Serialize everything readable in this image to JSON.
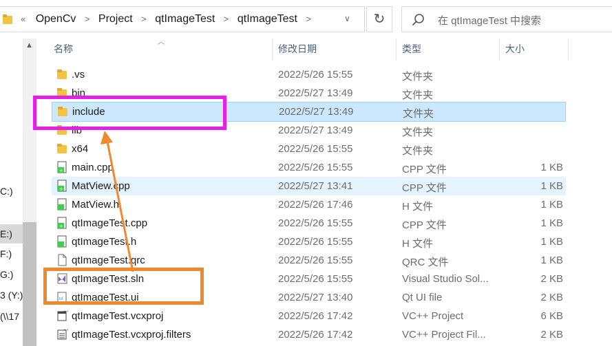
{
  "address": {
    "overflow": "«",
    "crumbs": [
      "OpenCv",
      "Project",
      "qtImageTest",
      "qtImageTest"
    ],
    "dropdown": "∨",
    "refresh": "↻"
  },
  "search": {
    "placeholder": "在 qtImageTest 中搜索"
  },
  "columns": {
    "name": "名称",
    "date": "修改日期",
    "type": "类型",
    "size": "大小"
  },
  "sidebar": {
    "drives": [
      {
        "label": "C:)"
      },
      {
        "label": "E:)"
      },
      {
        "label": "F:)"
      },
      {
        "label": "G:)"
      },
      {
        "label": "3 (Y:)"
      },
      {
        "label": "(\\\\17"
      }
    ]
  },
  "files": [
    {
      "name": ".vs",
      "date": "2022/5/26 15:55",
      "type": "文件夹",
      "size": "",
      "icon": "folder-icon"
    },
    {
      "name": "bin",
      "date": "2022/5/27 13:49",
      "type": "文件夹",
      "size": "",
      "icon": "folder-icon"
    },
    {
      "name": "include",
      "date": "2022/5/27 13:49",
      "type": "文件夹",
      "size": "",
      "icon": "folder-icon"
    },
    {
      "name": "lib",
      "date": "2022/5/27 13:49",
      "type": "文件夹",
      "size": "",
      "icon": "folder-icon"
    },
    {
      "name": "x64",
      "date": "2022/5/26 15:55",
      "type": "文件夹",
      "size": "",
      "icon": "folder-icon"
    },
    {
      "name": "main.cpp",
      "date": "2022/5/26 15:55",
      "type": "CPP 文件",
      "size": "1 KB",
      "icon": "cpp-file-icon"
    },
    {
      "name": "MatView.cpp",
      "date": "2022/5/27 13:41",
      "type": "CPP 文件",
      "size": "1 KB",
      "icon": "cpp-file-icon"
    },
    {
      "name": "MatView.h",
      "date": "2022/5/26 17:46",
      "type": "H 文件",
      "size": "1 KB",
      "icon": "h-file-icon"
    },
    {
      "name": "qtImageTest.cpp",
      "date": "2022/5/26 15:55",
      "type": "CPP 文件",
      "size": "1 KB",
      "icon": "cpp-file-icon"
    },
    {
      "name": "qtImageTest.h",
      "date": "2022/5/26 15:55",
      "type": "H 文件",
      "size": "1 KB",
      "icon": "h-file-icon"
    },
    {
      "name": "qtImageTest.qrc",
      "date": "2022/5/26 15:55",
      "type": "QRC 文件",
      "size": "1 KB",
      "icon": "blank-file-icon"
    },
    {
      "name": "qtImageTest.sln",
      "date": "2022/5/26 15:55",
      "type": "Visual Studio Sol...",
      "size": "2 KB",
      "icon": "vs-solution-icon"
    },
    {
      "name": "qtImageTest.ui",
      "date": "2022/5/27 13:40",
      "type": "Qt UI file",
      "size": "2 KB",
      "icon": "qt-ui-file-icon"
    },
    {
      "name": "qtImageTest.vcxproj",
      "date": "2022/5/26 17:42",
      "type": "VC++ Project",
      "size": "6 KB",
      "icon": "vcxproj-file-icon"
    },
    {
      "name": "qtImageTest.vcxproj.filters",
      "date": "2022/5/26 17:42",
      "type": "VC++ Project Fil...",
      "size": "2 KB",
      "icon": "vcxproj-filters-icon"
    }
  ],
  "colors": {
    "selected_bg": "#cce8ff",
    "hover_bg": "#e5f3ff",
    "magenta_highlight": "#e61ee6",
    "orange_highlight": "#f0882d",
    "folder": "#f5c342"
  }
}
